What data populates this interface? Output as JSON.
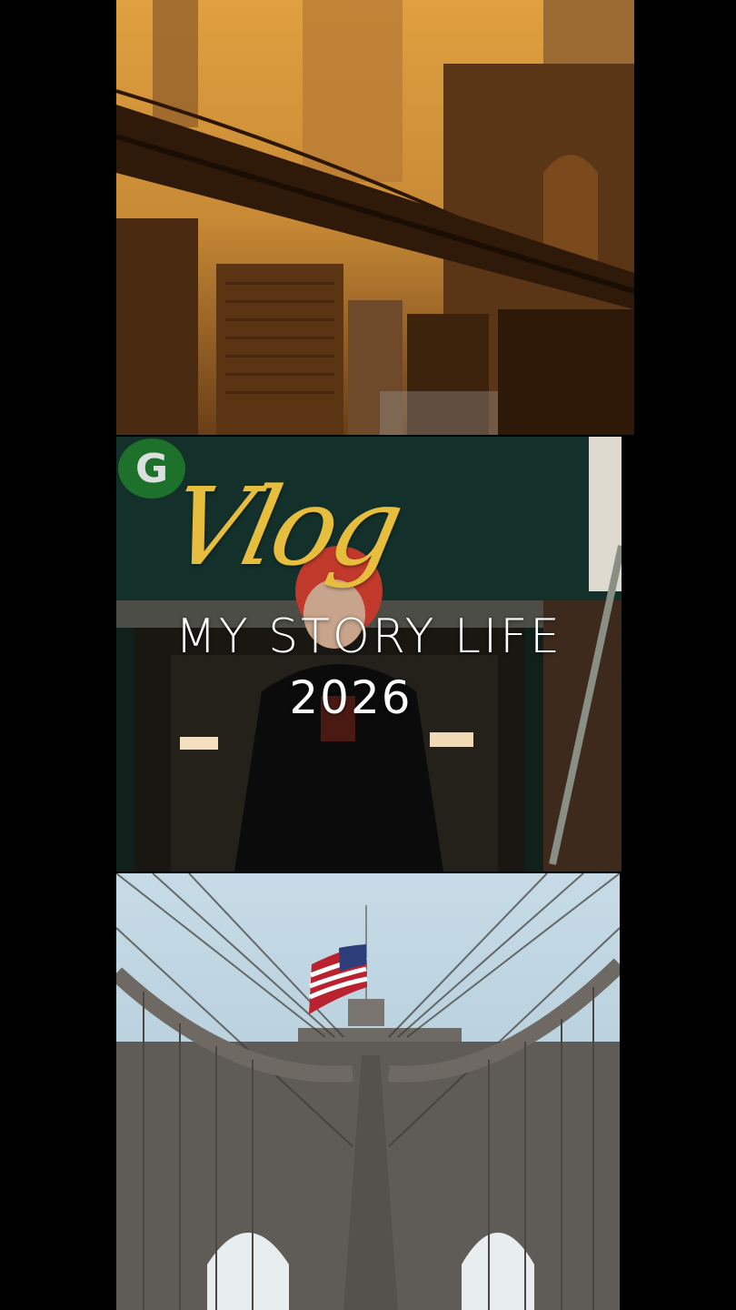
{
  "story": {
    "title_script": "Vlog",
    "title_line": "MY STORY LIFE",
    "year": "2026"
  },
  "scene_text": {
    "subway_line_letter": "G"
  },
  "colors": {
    "background": "#000000",
    "accent_gold": "#e7bd3e",
    "title_white": "#ffffff",
    "subway_green": "#1f7d2c"
  }
}
